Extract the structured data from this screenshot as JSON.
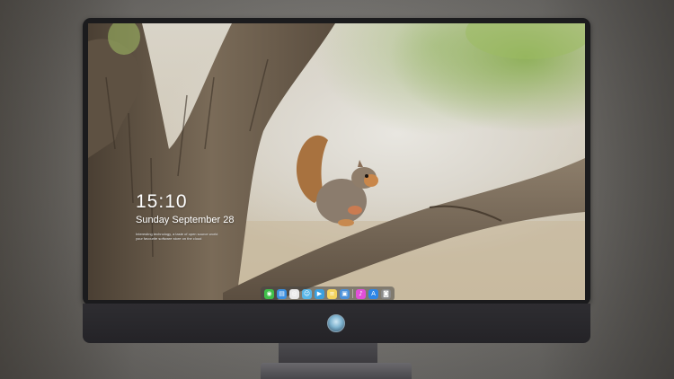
{
  "lock_screen": {
    "time": "15:10",
    "date": "Sunday September 28",
    "note_line1": "Interesting technology, a taste of open source world",
    "note_line2": "your favourite software store on the cloud"
  },
  "dock": {
    "items": [
      {
        "name": "messages",
        "icon": "chat-icon",
        "color": "#3fbf4a",
        "glyph": "◉"
      },
      {
        "name": "files",
        "icon": "folder-icon",
        "color": "#3b8fe0",
        "glyph": "▤"
      },
      {
        "name": "browser",
        "icon": "browser-icon",
        "color": "#e9e9e9",
        "glyph": "◎"
      },
      {
        "name": "finder",
        "icon": "finder-icon",
        "color": "#58b6e8",
        "glyph": "☺"
      },
      {
        "name": "video",
        "icon": "video-icon",
        "color": "#3aa0e0",
        "glyph": "▶"
      },
      {
        "name": "notes",
        "icon": "notes-icon",
        "color": "#f4d35e",
        "glyph": "≡"
      },
      {
        "name": "photos",
        "icon": "photos-icon",
        "color": "#4a90d9",
        "glyph": "▣"
      },
      {
        "name": "music",
        "icon": "music-icon",
        "color": "#e24fd8",
        "glyph": "♪"
      },
      {
        "name": "app-store",
        "icon": "app-store-icon",
        "color": "#2e86e6",
        "glyph": "A"
      },
      {
        "name": "camera",
        "icon": "camera-icon",
        "color": "#8a8a8a",
        "glyph": "◙"
      }
    ]
  }
}
